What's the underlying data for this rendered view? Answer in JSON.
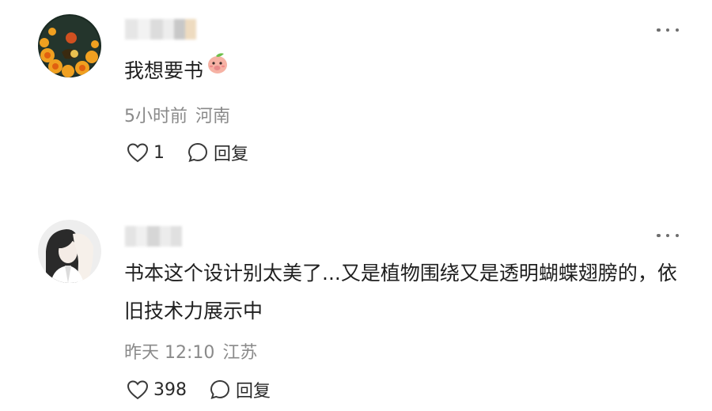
{
  "comments": [
    {
      "text": "我想要书",
      "time": "5小时前",
      "location": "河南",
      "likes": "1",
      "reply_label": "回复"
    },
    {
      "text": "书本这个设计别太美了...又是植物围绕又是透明蝴蝶翅膀的，依旧技术力展示中",
      "time": "昨天 12:10",
      "location": "江苏",
      "likes": "398",
      "reply_label": "回复"
    }
  ],
  "icons": [
    "heart-icon",
    "comment-bubble-icon",
    "more-options-icon"
  ],
  "colors": {
    "text": "#1f1f1f",
    "meta": "#8a8a8a",
    "background": "#ffffff"
  }
}
